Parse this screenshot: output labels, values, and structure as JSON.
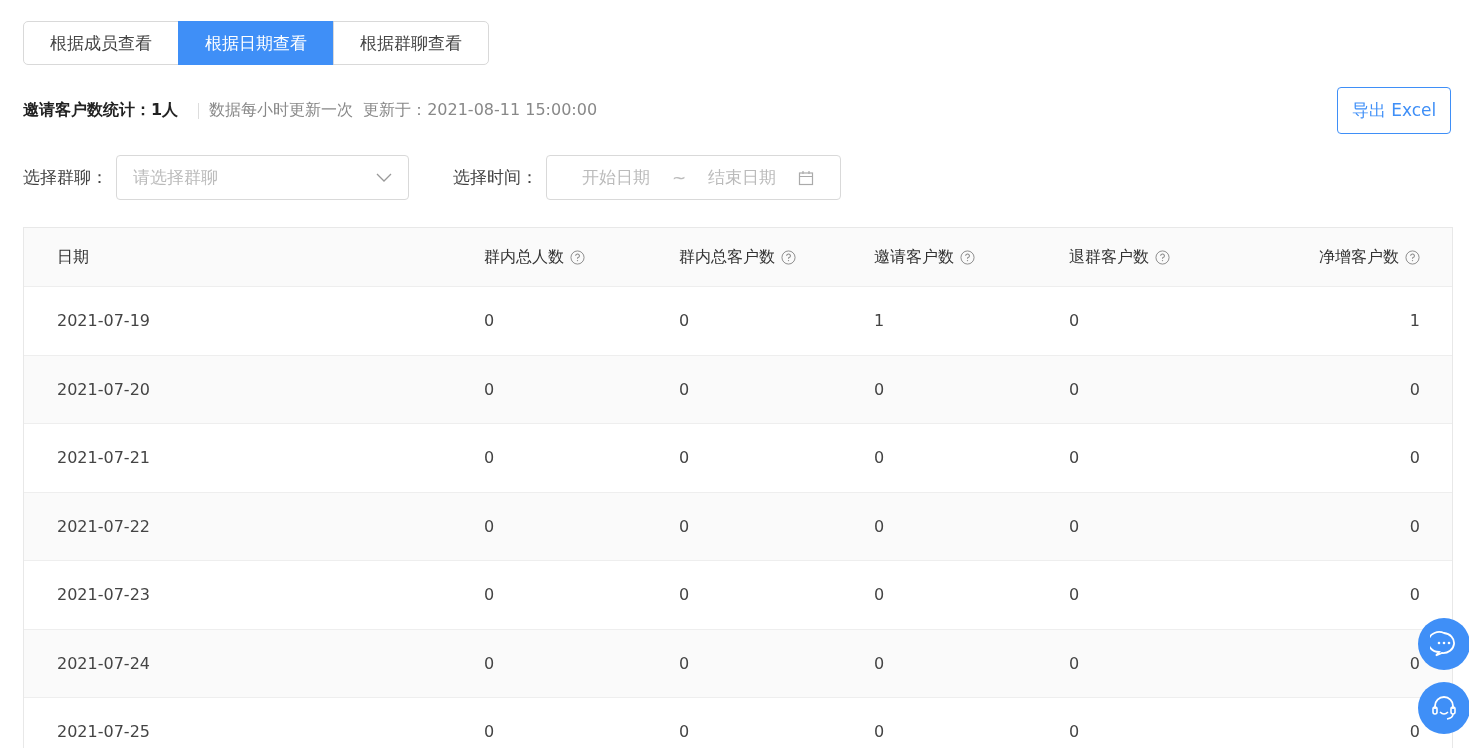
{
  "view_tabs": [
    {
      "label": "根据成员查看",
      "selected": false
    },
    {
      "label": "根据日期查看",
      "selected": true
    },
    {
      "label": "根据群聊查看",
      "selected": false
    }
  ],
  "summary": {
    "label": "邀请客户数统计：",
    "value": "1人",
    "note": "数据每小时更新一次",
    "updated": "更新于：2021-08-11 15:00:00"
  },
  "export_button": "导出 Excel",
  "filters": {
    "group_label": "选择群聊：",
    "group_placeholder": "请选择群聊",
    "time_label": "选择时间：",
    "start_placeholder": "开始日期",
    "separator": "~",
    "end_placeholder": "结束日期"
  },
  "table": {
    "columns": [
      {
        "label": "日期",
        "help": false
      },
      {
        "label": "群内总人数",
        "help": true
      },
      {
        "label": "群内总客户数",
        "help": true
      },
      {
        "label": "邀请客户数",
        "help": true
      },
      {
        "label": "退群客户数",
        "help": true
      },
      {
        "label": "净增客户数",
        "help": true
      }
    ],
    "rows": [
      [
        "2021-07-19",
        "0",
        "0",
        "1",
        "0",
        "1"
      ],
      [
        "2021-07-20",
        "0",
        "0",
        "0",
        "0",
        "0"
      ],
      [
        "2021-07-21",
        "0",
        "0",
        "0",
        "0",
        "0"
      ],
      [
        "2021-07-22",
        "0",
        "0",
        "0",
        "0",
        "0"
      ],
      [
        "2021-07-23",
        "0",
        "0",
        "0",
        "0",
        "0"
      ],
      [
        "2021-07-24",
        "0",
        "0",
        "0",
        "0",
        "0"
      ],
      [
        "2021-07-25",
        "0",
        "0",
        "0",
        "0",
        "0"
      ]
    ]
  }
}
